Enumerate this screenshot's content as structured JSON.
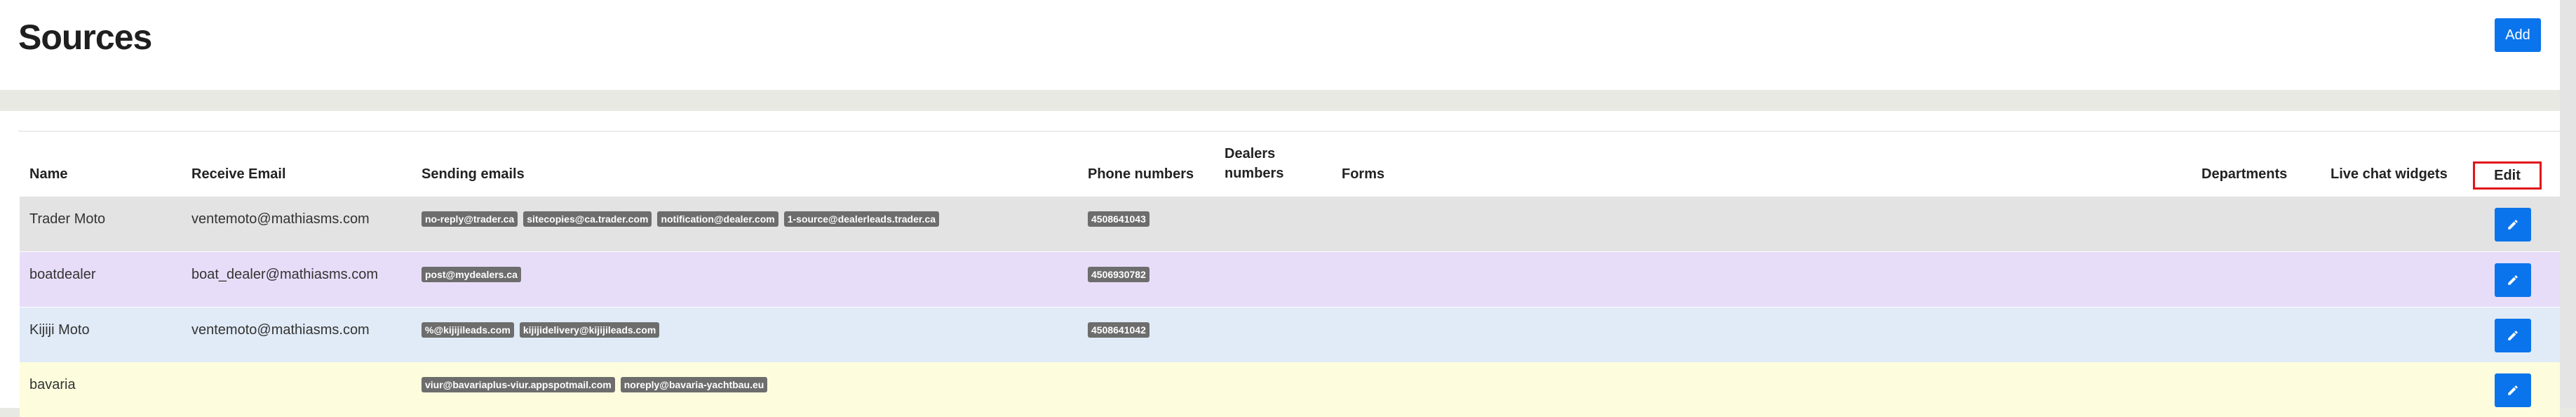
{
  "page": {
    "title": "Sources",
    "add_label": "Add"
  },
  "colors": {
    "accent": "#0a74ec",
    "highlight_border": "#e0141b",
    "row_colors": [
      "#e3e3e3",
      "#e8ddf9",
      "#e0ebf7",
      "#fdfdde"
    ]
  },
  "table": {
    "headers": {
      "name": "Name",
      "receive_email": "Receive Email",
      "sending_emails": "Sending emails",
      "phone_numbers": "Phone numbers",
      "dealers_numbers_1": "Dealers",
      "dealers_numbers_2": "numbers",
      "forms": "Forms",
      "departments": "Departments",
      "live_chat_widgets": "Live chat widgets",
      "edit": "Edit"
    },
    "rows": [
      {
        "name": "Trader Moto",
        "receive_email": "ventemoto@mathiasms.com",
        "sending_emails": [
          "no-reply@trader.ca",
          "sitecopies@ca.trader.com",
          "notification@dealer.com",
          "1-source@dealerleads.trader.ca"
        ],
        "phone_numbers": [
          "4508641043"
        ],
        "edit_icon": "pencil-icon"
      },
      {
        "name": "boatdealer",
        "receive_email": "boat_dealer@mathiasms.com",
        "sending_emails": [
          "post@mydealers.ca"
        ],
        "phone_numbers": [
          "4506930782"
        ],
        "edit_icon": "pencil-icon"
      },
      {
        "name": "Kijiji Moto",
        "receive_email": "ventemoto@mathiasms.com",
        "sending_emails": [
          "%@kijijileads.com",
          "kijijidelivery@kijijileads.com"
        ],
        "phone_numbers": [
          "4508641042"
        ],
        "edit_icon": "pencil-icon"
      },
      {
        "name": "bavaria",
        "receive_email": "",
        "sending_emails": [
          "viur@bavariaplus-viur.appspotmail.com",
          "noreply@bavaria-yachtbau.eu"
        ],
        "phone_numbers": [],
        "edit_icon": "pencil-icon"
      }
    ]
  }
}
